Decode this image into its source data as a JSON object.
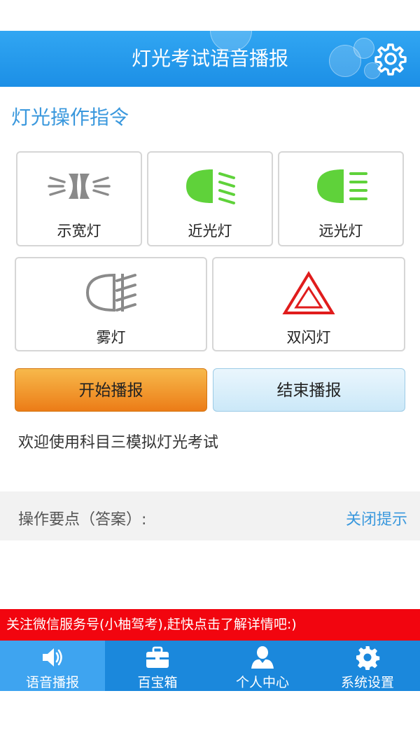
{
  "header": {
    "title": "灯光考试语音播报",
    "settings_icon": "gear-icon"
  },
  "section": {
    "title": "灯光操作指令"
  },
  "lights": [
    {
      "label": "示宽灯",
      "icon": "side-marker-light-icon",
      "color": "#8a8a8a"
    },
    {
      "label": "近光灯",
      "icon": "low-beam-icon",
      "color": "#5fd23a"
    },
    {
      "label": "远光灯",
      "icon": "high-beam-icon",
      "color": "#5fd23a"
    },
    {
      "label": "雾灯",
      "icon": "fog-light-icon",
      "color": "#8a8a8a"
    },
    {
      "label": "双闪灯",
      "icon": "hazard-light-icon",
      "color": "#e01c1c"
    }
  ],
  "controls": {
    "start_label": "开始播报",
    "stop_label": "结束播报"
  },
  "status": {
    "welcome": "欢迎使用科目三模拟灯光考试"
  },
  "tips": {
    "label": "操作要点（答案）:",
    "close_label": "关闭提示"
  },
  "promo": {
    "text": "关注微信服务号(小柚驾考),赶快点击了解详情吧:)"
  },
  "tabs": [
    {
      "label": "语音播报",
      "icon": "speaker-icon",
      "active": true
    },
    {
      "label": "百宝箱",
      "icon": "toolbox-icon",
      "active": false
    },
    {
      "label": "个人中心",
      "icon": "user-icon",
      "active": false
    },
    {
      "label": "系统设置",
      "icon": "gear-icon",
      "active": false
    }
  ],
  "colors": {
    "header": "#1c8fe6",
    "accent": "#3a98dd",
    "promo": "#f2050f",
    "tabbar": "#1b88dc"
  }
}
